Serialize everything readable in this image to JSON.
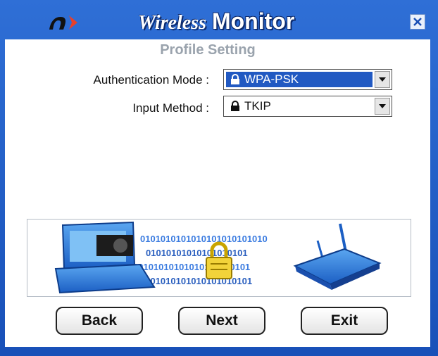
{
  "window": {
    "title_word1": "Wireless",
    "title_word2": "Monitor",
    "logo_icon": "n-logo-icon",
    "close_icon": "close-icon",
    "colors": {
      "frame": "#1f5cc7",
      "selection": "#2159c2",
      "accent_logo": "#e8402a"
    }
  },
  "page": {
    "subtitle": "Profile Setting"
  },
  "form": {
    "auth_mode": {
      "label": "Authentication Mode :",
      "value": "WPA-PSK",
      "icon": "lock-icon"
    },
    "input_method": {
      "label": "Input Method :",
      "value": "TKIP",
      "icon": "lock-icon"
    }
  },
  "banner": {
    "illustration": "laptop-padlock-router-illustration"
  },
  "buttons": {
    "back": "Back",
    "next": "Next",
    "exit": "Exit"
  }
}
